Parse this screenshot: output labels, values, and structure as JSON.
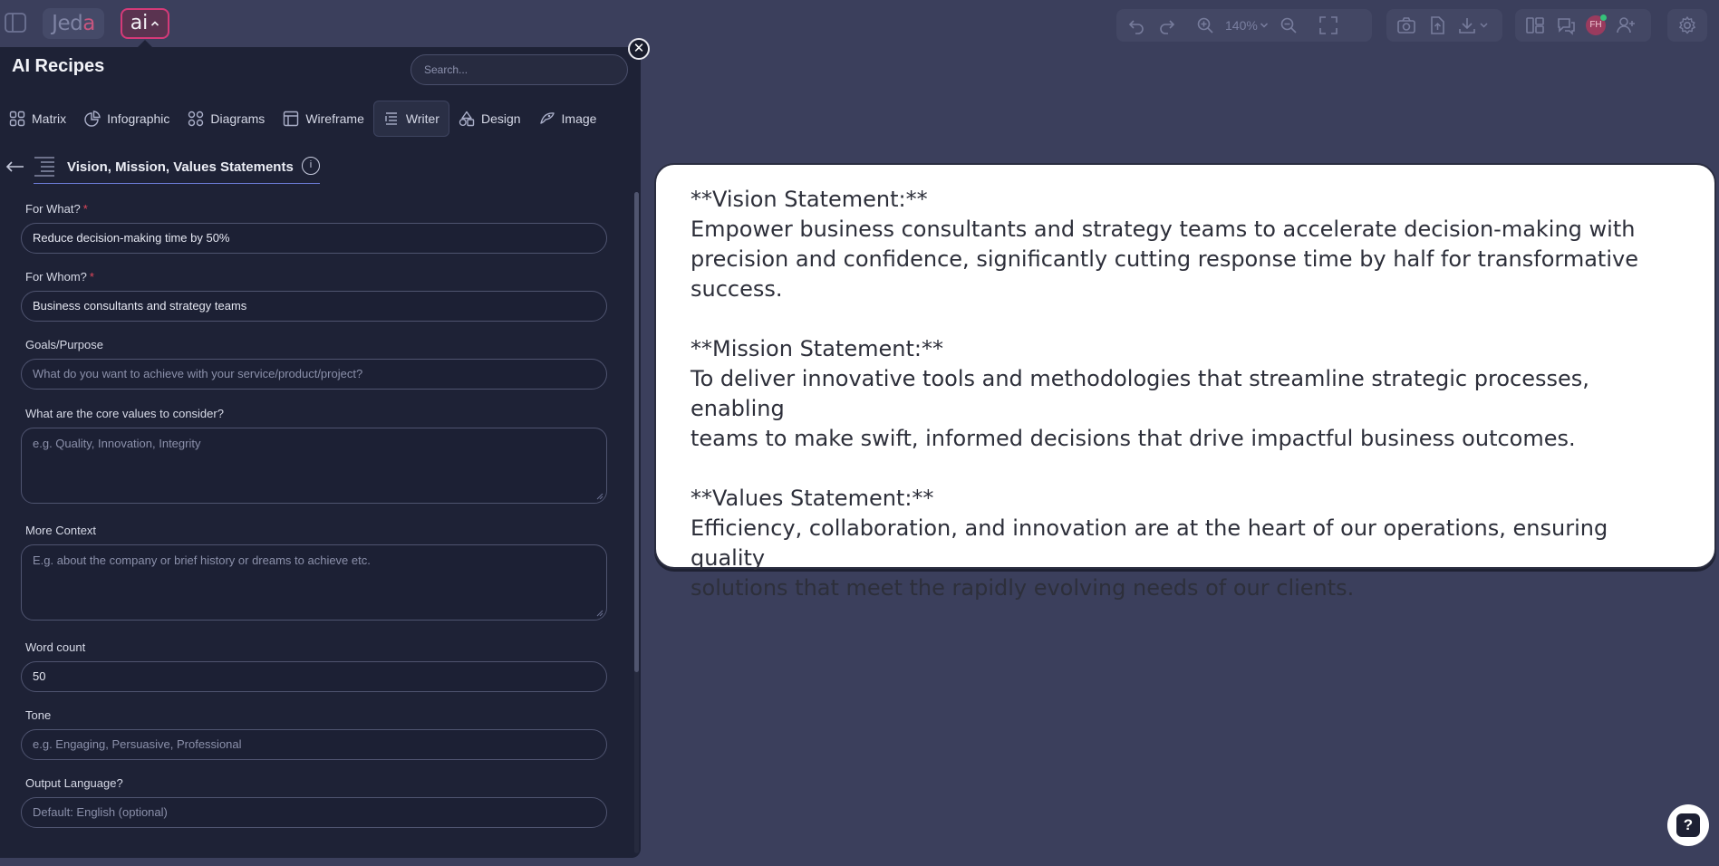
{
  "app": {
    "logo_text": "Jeda",
    "ai_button_label": "ai"
  },
  "toolbar": {
    "zoom_level": "140%",
    "avatar_initials": "FH"
  },
  "panel": {
    "title": "AI Recipes",
    "search_placeholder": "Search...",
    "close_symbol": "✕",
    "categories": [
      {
        "label": "Matrix",
        "icon": "grid-icon"
      },
      {
        "label": "Infographic",
        "icon": "pie-icon"
      },
      {
        "label": "Diagrams",
        "icon": "diagram-icon"
      },
      {
        "label": "Wireframe",
        "icon": "wireframe-icon"
      },
      {
        "label": "Writer",
        "icon": "writer-icon",
        "active": true
      },
      {
        "label": "Design",
        "icon": "shapes-icon"
      },
      {
        "label": "Image",
        "icon": "image-icon"
      }
    ],
    "recipe": {
      "title": "Vision, Mission, Values Statements",
      "info_symbol": "i"
    },
    "fields": {
      "for_what": {
        "label": "For What?",
        "required": "*",
        "value": "Reduce decision-making time by 50%"
      },
      "for_whom": {
        "label": "For Whom?",
        "required": "*",
        "value": "Business consultants and strategy teams"
      },
      "goals": {
        "label": "Goals/Purpose",
        "placeholder": "What do you want to achieve with your service/product/project?"
      },
      "core_values": {
        "label": "What are the core values to consider?",
        "placeholder": "e.g. Quality, Innovation, Integrity"
      },
      "context": {
        "label": "More Context",
        "placeholder": "E.g. about the company or brief history or dreams to achieve etc."
      },
      "word_count": {
        "label": "Word count",
        "value": "50"
      },
      "tone": {
        "label": "Tone",
        "placeholder": "e.g. Engaging, Persuasive, Professional"
      },
      "language": {
        "label": "Output Language?",
        "placeholder": "Default: English (optional)"
      }
    }
  },
  "card": {
    "vision_heading": "**Vision Statement:**",
    "vision_line1": "Empower business consultants and strategy teams to accelerate decision-making with",
    "vision_line2": "precision and confidence, significantly cutting response time by half for transformative",
    "vision_line3": "success.",
    "mission_heading": "**Mission Statement:**",
    "mission_line1": "To deliver innovative tools and methodologies that streamline strategic processes, enabling",
    "mission_line2": "teams to make swift, informed decisions that drive impactful business outcomes.",
    "values_heading": "**Values Statement:**",
    "values_line1": "Efficiency, collaboration, and innovation are at the heart of our operations, ensuring quality",
    "values_line2": "solutions that meet the rapidly evolving needs of our clients."
  },
  "help": {
    "symbol": "?"
  },
  "colors": {
    "background": "#3b3f5c",
    "panel": "#1e2236",
    "accent": "#d53a78",
    "card": "#ffffff"
  }
}
